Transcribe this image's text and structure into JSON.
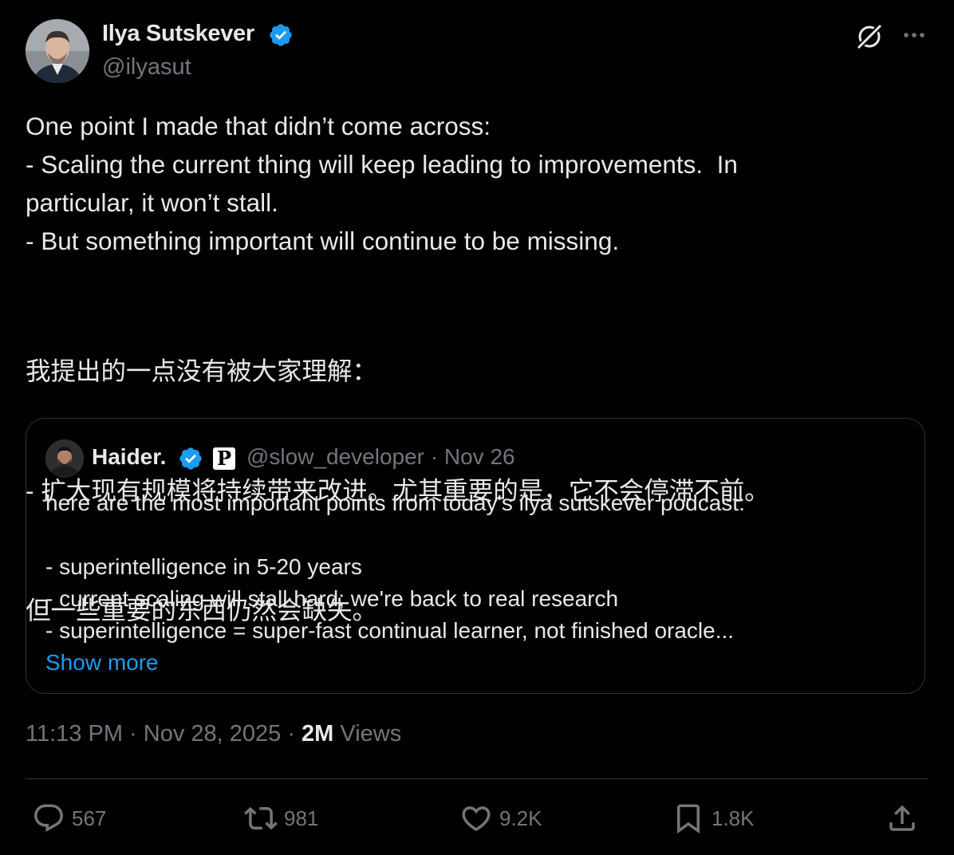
{
  "author": {
    "name": "Ilya Sutskever",
    "handle": "@ilyasut",
    "verified_color": "#1d9bf0"
  },
  "header_icons": [
    "grok-icon",
    "more-icon"
  ],
  "tweet": {
    "lines_en": [
      "One point I made that didn’t come across:",
      "- Scaling the current thing will keep leading to improvements.  In",
      "particular, it won’t stall.",
      "- But something important will continue to be missing."
    ],
    "lines_zh": [
      "我提出的一点没有被大家理解：",
      "- 扩大现有规模将持续带来改进。尤其重要的是，它不会停滞不前。",
      "但一些重要的东西仍然会缺失。"
    ]
  },
  "quote": {
    "name": "Haider.",
    "affiliate_badge": "P",
    "handle_date": "@slow_developer · Nov 26",
    "lines": [
      "here are the most important points from today's ilya sutskever podcast:",
      "- superintelligence in 5-20 years",
      "- current scaling will stall hard; we're back to real research",
      "- superintelligence = super-fast continual learner, not finished oracle..."
    ],
    "show_more": "Show more",
    "link_color": "#1d9bf0"
  },
  "meta": {
    "time_date": "11:13 PM · Nov 28, 2025 · ",
    "views_count": "2M",
    "views_label": " Views"
  },
  "actions": {
    "replies": "567",
    "reposts": "981",
    "likes": "9.2K",
    "bookmarks": "1.8K"
  }
}
